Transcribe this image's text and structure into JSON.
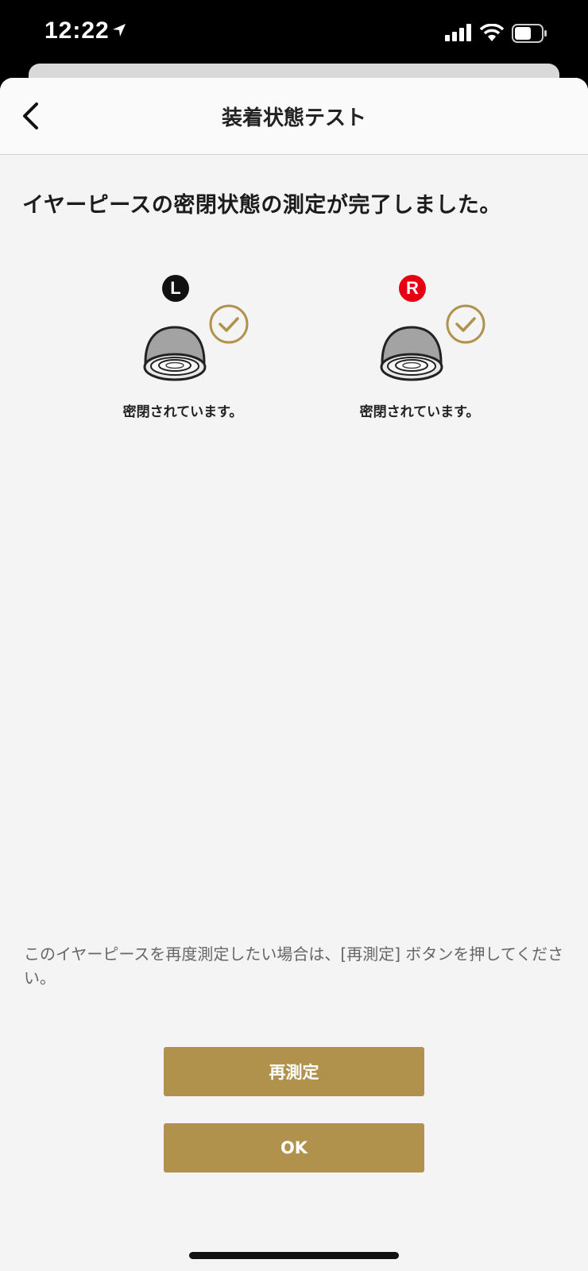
{
  "status_bar": {
    "time": "12:22",
    "icons": [
      "location-arrow-icon",
      "cellular-signal-icon",
      "wifi-icon",
      "battery-icon"
    ]
  },
  "nav": {
    "title": "装着状態テスト",
    "back_icon": "chevron-left-icon"
  },
  "headline": "イヤーピースの密閉状態の測定が完了しました。",
  "earpieces": [
    {
      "side": "L",
      "status": "密閉されています。",
      "badge_color": "#111111",
      "check_icon": "check-circle-icon"
    },
    {
      "side": "R",
      "status": "密閉されています。",
      "badge_color": "#e60012",
      "check_icon": "check-circle-icon"
    }
  ],
  "hint": "このイヤーピースを再度測定したい場合は、[再測定] ボタンを押してください。",
  "buttons": {
    "remeasure": "再測定",
    "ok": "OK"
  },
  "colors": {
    "accent": "#b0924c",
    "check": "#b0924c",
    "right_badge": "#e60012"
  }
}
